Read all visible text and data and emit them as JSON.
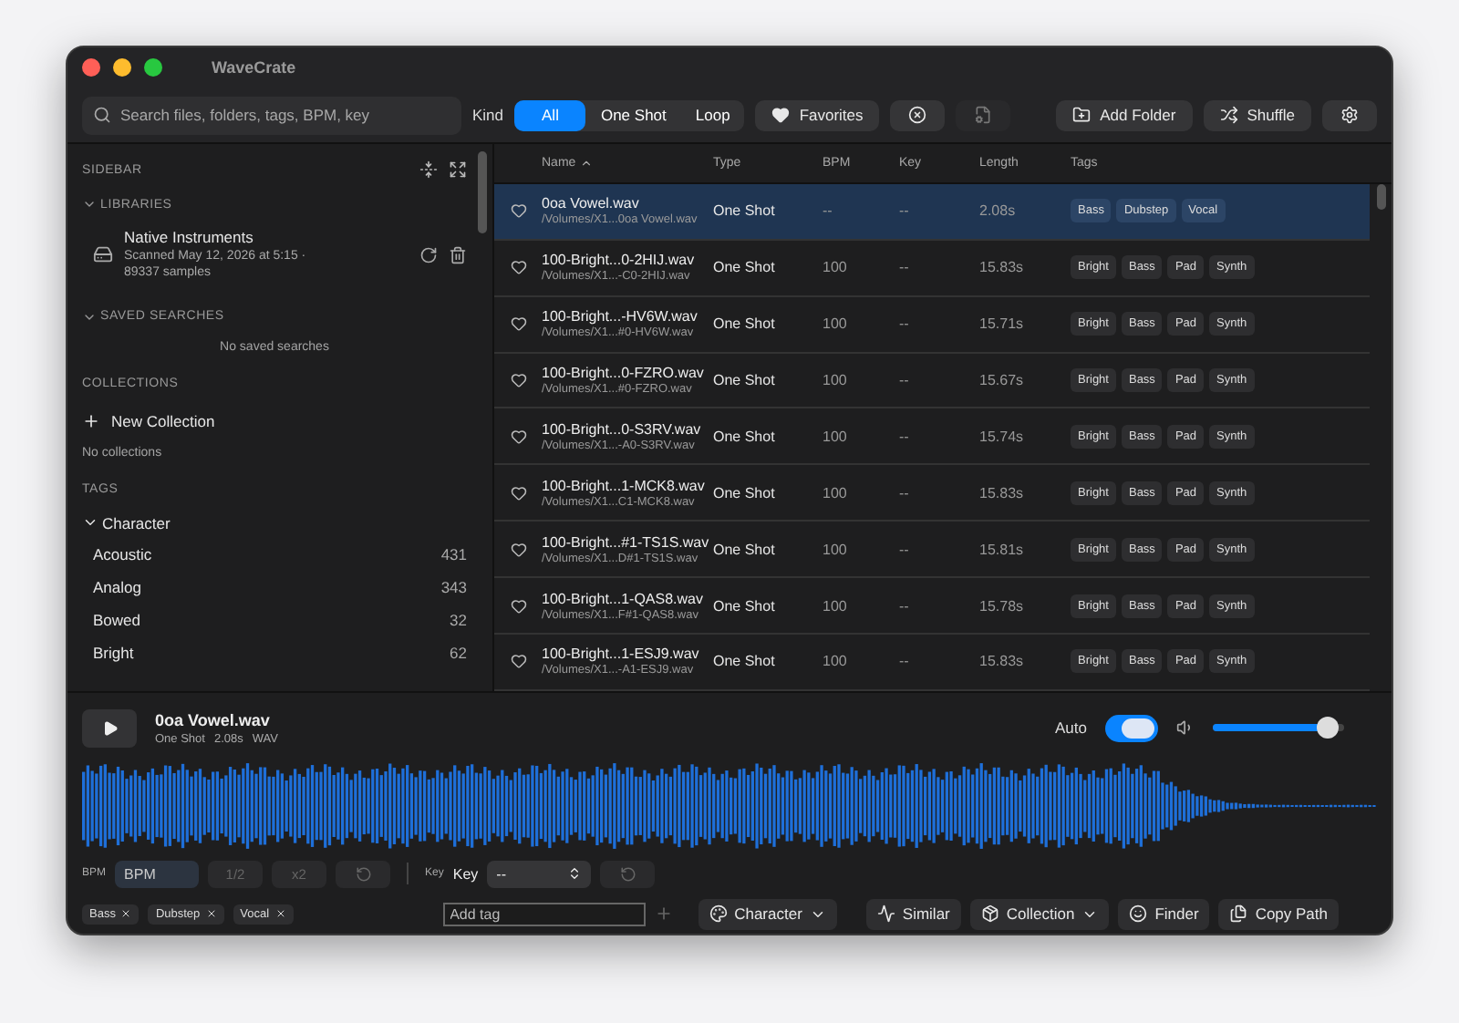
{
  "window": {
    "title": "WaveCrate"
  },
  "toolbar": {
    "search": {
      "placeholder": "Search files, folders, tags, BPM, key"
    },
    "kind_label": "Kind",
    "kind_tabs": [
      {
        "label": "All",
        "selected": true
      },
      {
        "label": "One Shot",
        "selected": false
      },
      {
        "label": "Loop",
        "selected": false
      }
    ],
    "left_buttons": [
      {
        "kind": "favorites",
        "label": "Favorites",
        "disabled": false
      },
      {
        "kind": "clear",
        "disabled": false
      },
      {
        "kind": "file-settings",
        "disabled": true
      }
    ],
    "right_buttons": [
      {
        "kind": "add-folder",
        "label": "Add Folder"
      },
      {
        "kind": "shuffle",
        "label": "Shuffle"
      },
      {
        "kind": "settings"
      }
    ]
  },
  "sidebar": {
    "title": "SIDEBAR",
    "libraries": {
      "title": "LIBRARIES",
      "expanded": true,
      "items": [
        {
          "name": "Native Instruments",
          "detail": "Scanned May 12, 2026 at 5:15 · 89337 samples"
        }
      ]
    },
    "saved_searches": {
      "title": "SAVED SEARCHES",
      "expanded": true,
      "empty": "No saved searches"
    },
    "collections": {
      "title": "COLLECTIONS",
      "new_label": "New Collection",
      "empty": "No collections"
    },
    "tags": {
      "title": "TAGS",
      "groups": [
        {
          "name": "Character",
          "expanded": true,
          "items": [
            {
              "name": "Acoustic",
              "count": "431"
            },
            {
              "name": "Analog",
              "count": "343"
            },
            {
              "name": "Bowed",
              "count": "32"
            },
            {
              "name": "Bright",
              "count": "62"
            }
          ]
        }
      ]
    }
  },
  "table": {
    "columns": [
      {
        "label": "Name",
        "sorted": true
      },
      {
        "label": "Type",
        "sorted": false
      },
      {
        "label": "BPM",
        "sorted": false
      },
      {
        "label": "Key",
        "sorted": false
      },
      {
        "label": "Length",
        "sorted": false
      },
      {
        "label": "Tags",
        "sorted": false
      }
    ],
    "rows": [
      {
        "name": "0oa Vowel.wav",
        "path": "/Volumes/X1...0oa Vowel.wav",
        "type": "One Shot",
        "bpm": "--",
        "key": "--",
        "length": "2.08s",
        "tags": [
          "Bass",
          "Dubstep",
          "Vocal"
        ],
        "selected": true,
        "favorite": false
      },
      {
        "name": "100-Bright...0-2HIJ.wav",
        "path": "/Volumes/X1...-C0-2HIJ.wav",
        "type": "One Shot",
        "bpm": "100",
        "key": "--",
        "length": "15.83s",
        "tags": [
          "Bright",
          "Bass",
          "Pad",
          "Synth"
        ],
        "selected": false,
        "favorite": false
      },
      {
        "name": "100-Bright...-HV6W.wav",
        "path": "/Volumes/X1...#0-HV6W.wav",
        "type": "One Shot",
        "bpm": "100",
        "key": "--",
        "length": "15.71s",
        "tags": [
          "Bright",
          "Bass",
          "Pad",
          "Synth"
        ],
        "selected": false,
        "favorite": false
      },
      {
        "name": "100-Bright...0-FZRO.wav",
        "path": "/Volumes/X1...#0-FZRO.wav",
        "type": "One Shot",
        "bpm": "100",
        "key": "--",
        "length": "15.67s",
        "tags": [
          "Bright",
          "Bass",
          "Pad",
          "Synth"
        ],
        "selected": false,
        "favorite": false
      },
      {
        "name": "100-Bright...0-S3RV.wav",
        "path": "/Volumes/X1...-A0-S3RV.wav",
        "type": "One Shot",
        "bpm": "100",
        "key": "--",
        "length": "15.74s",
        "tags": [
          "Bright",
          "Bass",
          "Pad",
          "Synth"
        ],
        "selected": false,
        "favorite": false
      },
      {
        "name": "100-Bright...1-MCK8.wav",
        "path": "/Volumes/X1...C1-MCK8.wav",
        "type": "One Shot",
        "bpm": "100",
        "key": "--",
        "length": "15.83s",
        "tags": [
          "Bright",
          "Bass",
          "Pad",
          "Synth"
        ],
        "selected": false,
        "favorite": false
      },
      {
        "name": "100-Bright...#1-TS1S.wav",
        "path": "/Volumes/X1...D#1-TS1S.wav",
        "type": "One Shot",
        "bpm": "100",
        "key": "--",
        "length": "15.81s",
        "tags": [
          "Bright",
          "Bass",
          "Pad",
          "Synth"
        ],
        "selected": false,
        "favorite": false
      },
      {
        "name": "100-Bright...1-QAS8.wav",
        "path": "/Volumes/X1...F#1-QAS8.wav",
        "type": "One Shot",
        "bpm": "100",
        "key": "--",
        "length": "15.78s",
        "tags": [
          "Bright",
          "Bass",
          "Pad",
          "Synth"
        ],
        "selected": false,
        "favorite": false
      },
      {
        "name": "100-Bright...1-ESJ9.wav",
        "path": "/Volumes/X1...-A1-ESJ9.wav",
        "type": "One Shot",
        "bpm": "100",
        "key": "--",
        "length": "15.83s",
        "tags": [
          "Bright",
          "Bass",
          "Pad",
          "Synth"
        ],
        "selected": false,
        "favorite": false
      }
    ]
  },
  "player": {
    "title": "0oa Vowel.wav",
    "meta": [
      "One Shot",
      "2.08s",
      "WAV"
    ],
    "auto": {
      "label": "Auto",
      "on": true
    },
    "volume": {
      "level": 0.88
    },
    "bpm": {
      "label": "BPM",
      "placeholder": "BPM",
      "buttons": [
        {
          "kind": "text",
          "label": "1/2",
          "disabled": true
        },
        {
          "kind": "text",
          "label": "x2",
          "disabled": true
        },
        {
          "kind": "reset",
          "disabled": true
        }
      ]
    },
    "key": {
      "label": "Key",
      "title": "Key",
      "value": "--",
      "reset_disabled": true
    },
    "tags": [
      "Bass",
      "Dubstep",
      "Vocal"
    ],
    "add_tag": {
      "placeholder": "Add tag"
    },
    "actions": [
      {
        "kind": "character",
        "label": "Character",
        "menu": true
      },
      {
        "kind": "similar",
        "label": "Similar",
        "menu": false
      },
      {
        "kind": "collection",
        "label": "Collection",
        "menu": true
      },
      {
        "kind": "finder",
        "label": "Finder",
        "menu": false
      },
      {
        "kind": "copy-path",
        "label": "Copy Path",
        "menu": false
      }
    ]
  }
}
